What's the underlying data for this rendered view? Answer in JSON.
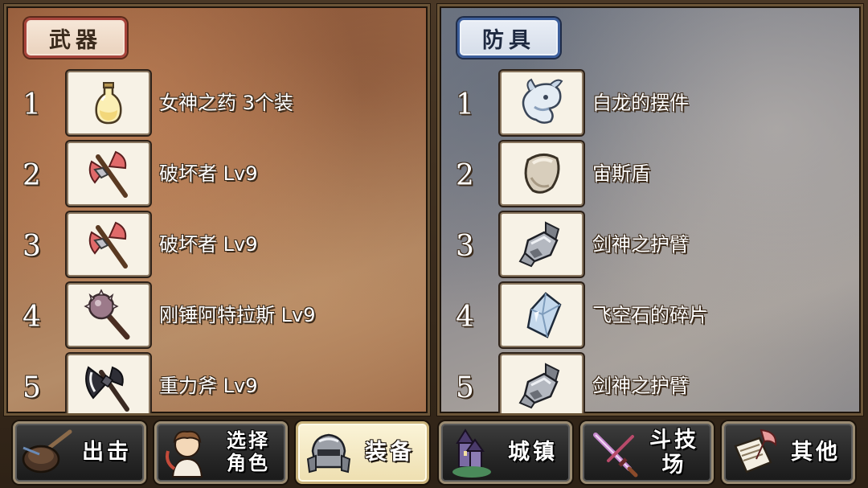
{
  "weapons": {
    "tab_label": "武器",
    "items": [
      {
        "num": "1",
        "name": "女神之药 3个装",
        "icon": "potion-bottle-icon"
      },
      {
        "num": "2",
        "name": "破坏者 Lv9",
        "icon": "red-axe-icon"
      },
      {
        "num": "3",
        "name": "破坏者 Lv9",
        "icon": "red-axe-icon"
      },
      {
        "num": "4",
        "name": "刚锤阿特拉斯 Lv9",
        "icon": "spiked-mace-icon"
      },
      {
        "num": "5",
        "name": "重力斧 Lv9",
        "icon": "black-axe-icon"
      }
    ]
  },
  "armor": {
    "tab_label": "防具",
    "items": [
      {
        "num": "1",
        "name": "白龙的摆件",
        "icon": "white-dragon-icon"
      },
      {
        "num": "2",
        "name": "宙斯盾",
        "icon": "shield-icon"
      },
      {
        "num": "3",
        "name": "剑神之护臂",
        "icon": "gauntlet-icon"
      },
      {
        "num": "4",
        "name": "飞空石的碎片",
        "icon": "crystal-shard-icon"
      },
      {
        "num": "5",
        "name": "剑神之护臂",
        "icon": "gauntlet-icon"
      }
    ]
  },
  "nav": {
    "sortie": "出击",
    "select_character": "选择\n角色",
    "equipment": "装备",
    "town": "城镇",
    "arena": "斗技场",
    "other": "其他",
    "active": "equipment"
  },
  "colors": {
    "weapon_tab_border": "#a8453c",
    "armor_tab_border": "#3d5f9c",
    "active_nav_bg": "#f5e9c0"
  }
}
